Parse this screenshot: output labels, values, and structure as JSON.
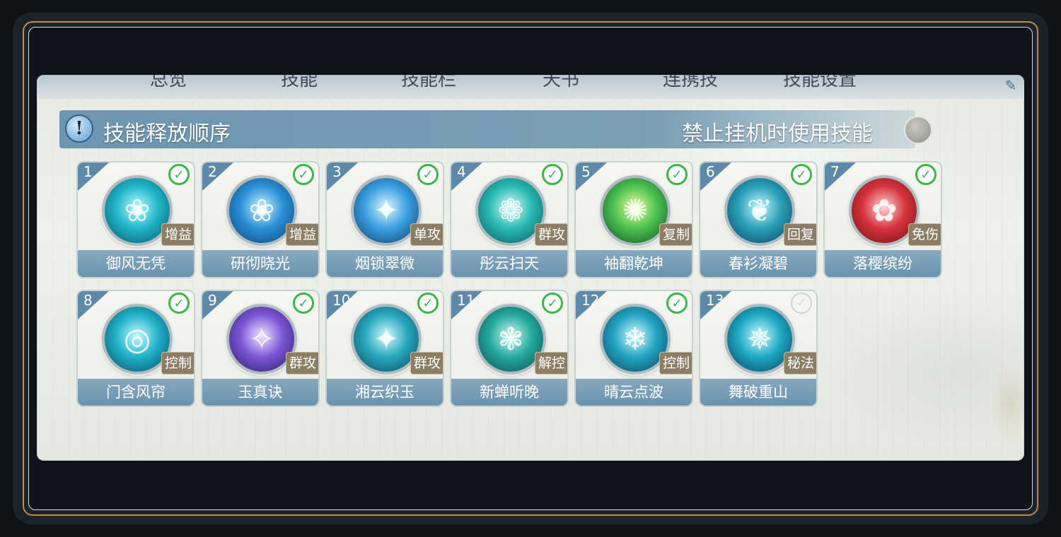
{
  "tabs": [
    "总览",
    "技能",
    "技能栏",
    "天书",
    "连携技",
    "技能设置"
  ],
  "header": {
    "info_icon": "!",
    "title": "技能释放顺序",
    "toggle_label": "禁止挂机时使用技能",
    "toggle_on": false
  },
  "skills": [
    {
      "num": "1",
      "name": "御风无凭",
      "tag": "增益",
      "checked": true,
      "colors": [
        "#b9fbff",
        "#1fb5c9",
        "#0c4f63"
      ],
      "glyph": "❀"
    },
    {
      "num": "2",
      "name": "研彻晓光",
      "tag": "增益",
      "checked": true,
      "colors": [
        "#c9f2ff",
        "#2a8fd6",
        "#0d3f6e"
      ],
      "glyph": "❀"
    },
    {
      "num": "3",
      "name": "烟锁翠微",
      "tag": "单攻",
      "checked": true,
      "colors": [
        "#dff6ff",
        "#3a9fe0",
        "#0e3a66"
      ],
      "glyph": "✦"
    },
    {
      "num": "4",
      "name": "彤云扫天",
      "tag": "群攻",
      "checked": true,
      "colors": [
        "#d8fff7",
        "#29b9b3",
        "#0b5259"
      ],
      "glyph": "❁"
    },
    {
      "num": "5",
      "name": "袖翻乾坤",
      "tag": "复制",
      "checked": true,
      "colors": [
        "#e7ff9a",
        "#4cc150",
        "#0f4d2b"
      ],
      "glyph": "✺"
    },
    {
      "num": "6",
      "name": "春衫凝碧",
      "tag": "回复",
      "checked": true,
      "colors": [
        "#c8f8ff",
        "#2a9fb8",
        "#0d3f5c"
      ],
      "glyph": "❦"
    },
    {
      "num": "7",
      "name": "落樱缤纷",
      "tag": "免伤",
      "checked": true,
      "colors": [
        "#ffd6d6",
        "#d6333c",
        "#6b0e14"
      ],
      "glyph": "✿"
    },
    {
      "num": "8",
      "name": "门含风帘",
      "tag": "控制",
      "checked": true,
      "colors": [
        "#c8fbff",
        "#1fb0c8",
        "#0a4a5c"
      ],
      "glyph": "◎"
    },
    {
      "num": "9",
      "name": "玉真诀",
      "tag": "群攻",
      "checked": true,
      "colors": [
        "#f3e6ff",
        "#7a55d6",
        "#2a1a5e"
      ],
      "glyph": "✧"
    },
    {
      "num": "10",
      "name": "湘云织玉",
      "tag": "群攻",
      "checked": true,
      "colors": [
        "#d4fbff",
        "#27a7bd",
        "#0c4556"
      ],
      "glyph": "✦"
    },
    {
      "num": "11",
      "name": "新蝉听晚",
      "tag": "解控",
      "checked": true,
      "colors": [
        "#cff9f2",
        "#23a89e",
        "#0b4a4a"
      ],
      "glyph": "❃"
    },
    {
      "num": "12",
      "name": "晴云点波",
      "tag": "控制",
      "checked": true,
      "colors": [
        "#d6fbff",
        "#22a3c2",
        "#0b425a"
      ],
      "glyph": "❄"
    },
    {
      "num": "13",
      "name": "舞破重山",
      "tag": "秘法",
      "checked": false,
      "colors": [
        "#cffcff",
        "#1ea8c4",
        "#083c52"
      ],
      "glyph": "✵"
    }
  ]
}
